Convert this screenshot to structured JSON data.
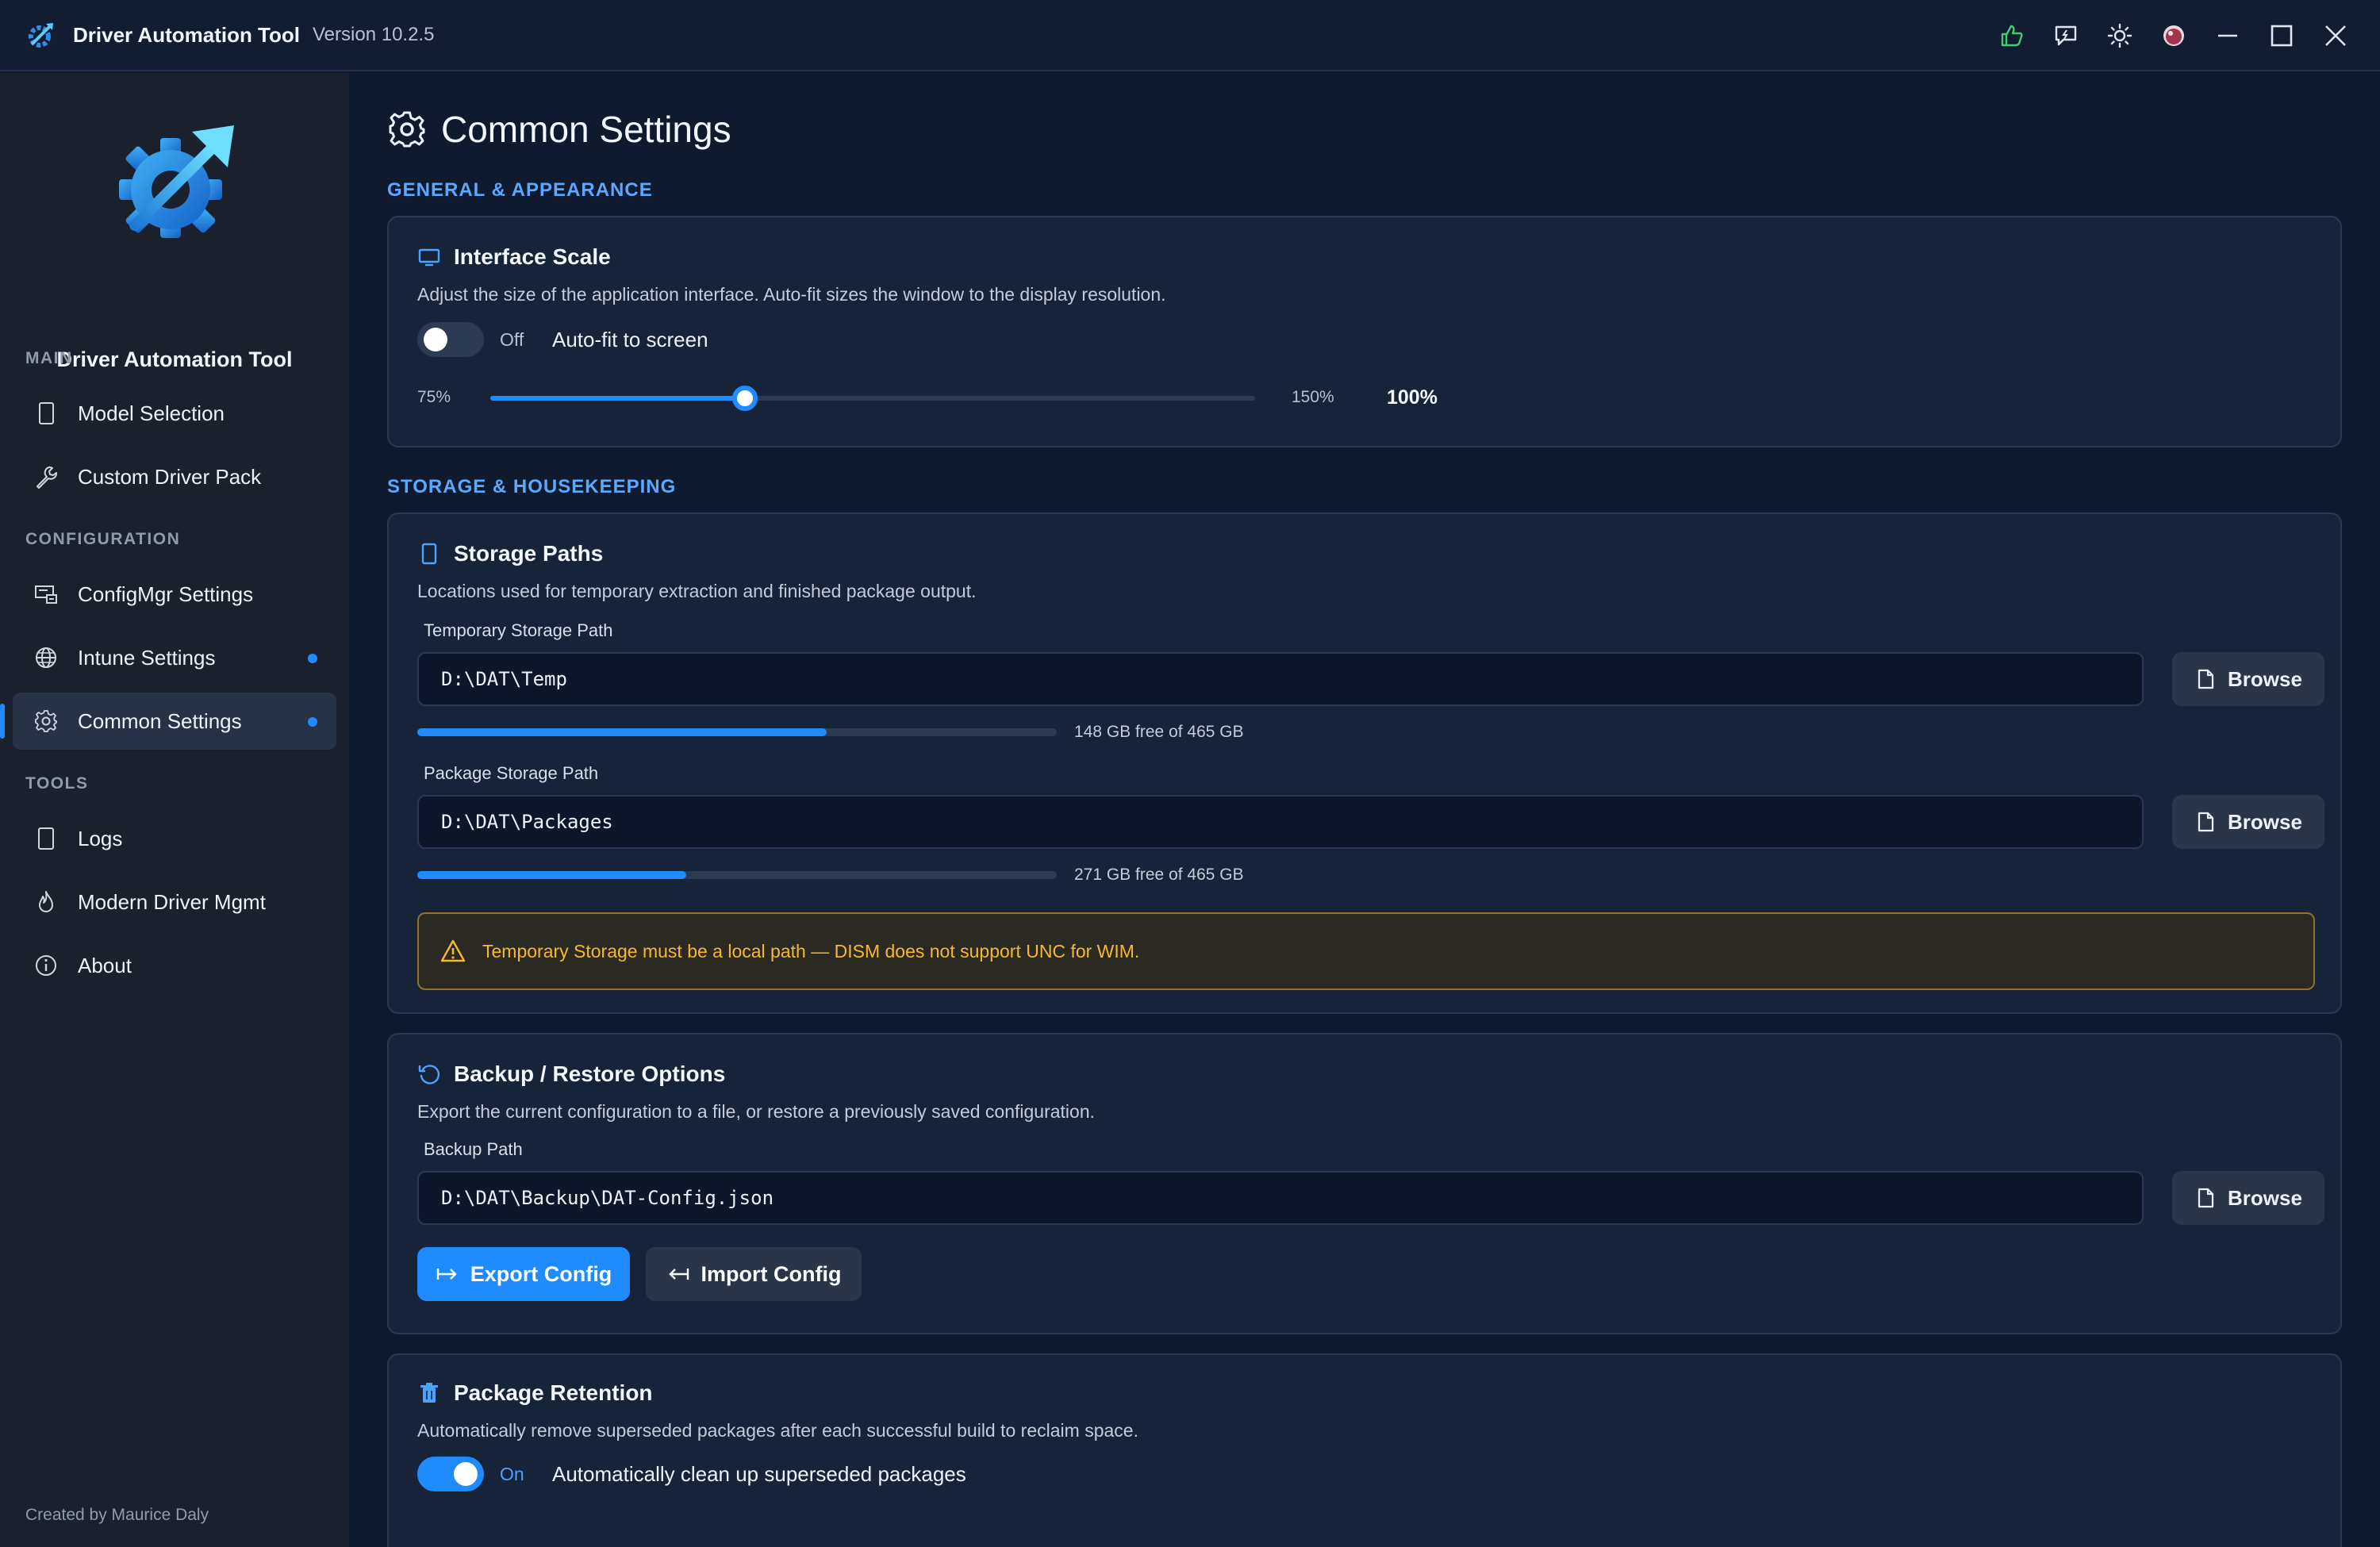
{
  "window": {
    "title": "Driver Automation Tool",
    "version": "Version 10.2.5",
    "controls": [
      "thumbs-up-icon",
      "feedback-icon",
      "theme-sun-icon",
      "avatar-icon",
      "minimize-icon",
      "maximize-icon",
      "close-icon"
    ]
  },
  "sidebar": {
    "app_name": "Driver Automation Tool",
    "sections": {
      "main": "MAIN",
      "configuration": "CONFIGURATION",
      "tools": "TOOLS"
    },
    "items": [
      {
        "label": "Model Selection",
        "icon": "tablet-icon"
      },
      {
        "label": "Custom Driver Pack",
        "icon": "wrench-icon"
      },
      {
        "label": "ConfigMgr Settings",
        "icon": "server-icon"
      },
      {
        "label": "Intune Settings",
        "icon": "globe-icon",
        "dot": true
      },
      {
        "label": "Common Settings",
        "icon": "gear-icon",
        "dot": true,
        "active": true
      },
      {
        "label": "Logs",
        "icon": "document-icon"
      },
      {
        "label": "Modern Driver Mgmt",
        "icon": "flame-icon"
      },
      {
        "label": "About",
        "icon": "info-icon"
      }
    ],
    "footer": "Created by Maurice Daly"
  },
  "page": {
    "title": "Common Settings",
    "sections": {
      "general": "GENERAL & APPEARANCE",
      "storage": "STORAGE & HOUSEKEEPING"
    }
  },
  "interface_scale": {
    "title": "Interface Scale",
    "description": "Adjust the size of the application interface. Auto-fit sizes the window to the display resolution.",
    "toggle_state": "Off",
    "toggle_label": "Auto-fit to screen",
    "toggle_on": false,
    "slider_min": "75%",
    "slider_max": "150%",
    "slider_value": "100%",
    "slider_fraction": 0.333
  },
  "storage_paths": {
    "title": "Storage Paths",
    "description": "Locations used for temporary extraction and finished package output.",
    "temp_label": "Temporary Storage Path",
    "temp_value": "D:\\DAT\\Temp",
    "temp_usage_text": "148 GB free of 465 GB",
    "temp_used_fraction": 0.64,
    "package_label": "Package Storage Path",
    "package_value": "D:\\DAT\\Packages",
    "package_usage_text": "271 GB free of 465 GB",
    "package_used_fraction": 0.42,
    "browse_label": "Browse",
    "warning": "Temporary Storage must be a local path — DISM does not support UNC for WIM."
  },
  "backup": {
    "title": "Backup / Restore Options",
    "description": "Export the current configuration to a file, or restore a previously saved configuration.",
    "path_label": "Backup Path",
    "path_value": "D:\\DAT\\Backup\\DAT-Config.json",
    "browse_label": "Browse",
    "export_label": "Export Config",
    "import_label": "Import Config"
  },
  "retention": {
    "title": "Package Retention",
    "description": "Automatically remove superseded packages after each successful build to reclaim space.",
    "toggle_state": "On",
    "toggle_label": "Automatically clean up superseded packages",
    "toggle_on": true
  },
  "colors": {
    "accent": "#1f8bff",
    "background": "#0f1a2e",
    "sidebar": "#1a212c",
    "card": "#172338",
    "warning": "#f5b82e"
  }
}
